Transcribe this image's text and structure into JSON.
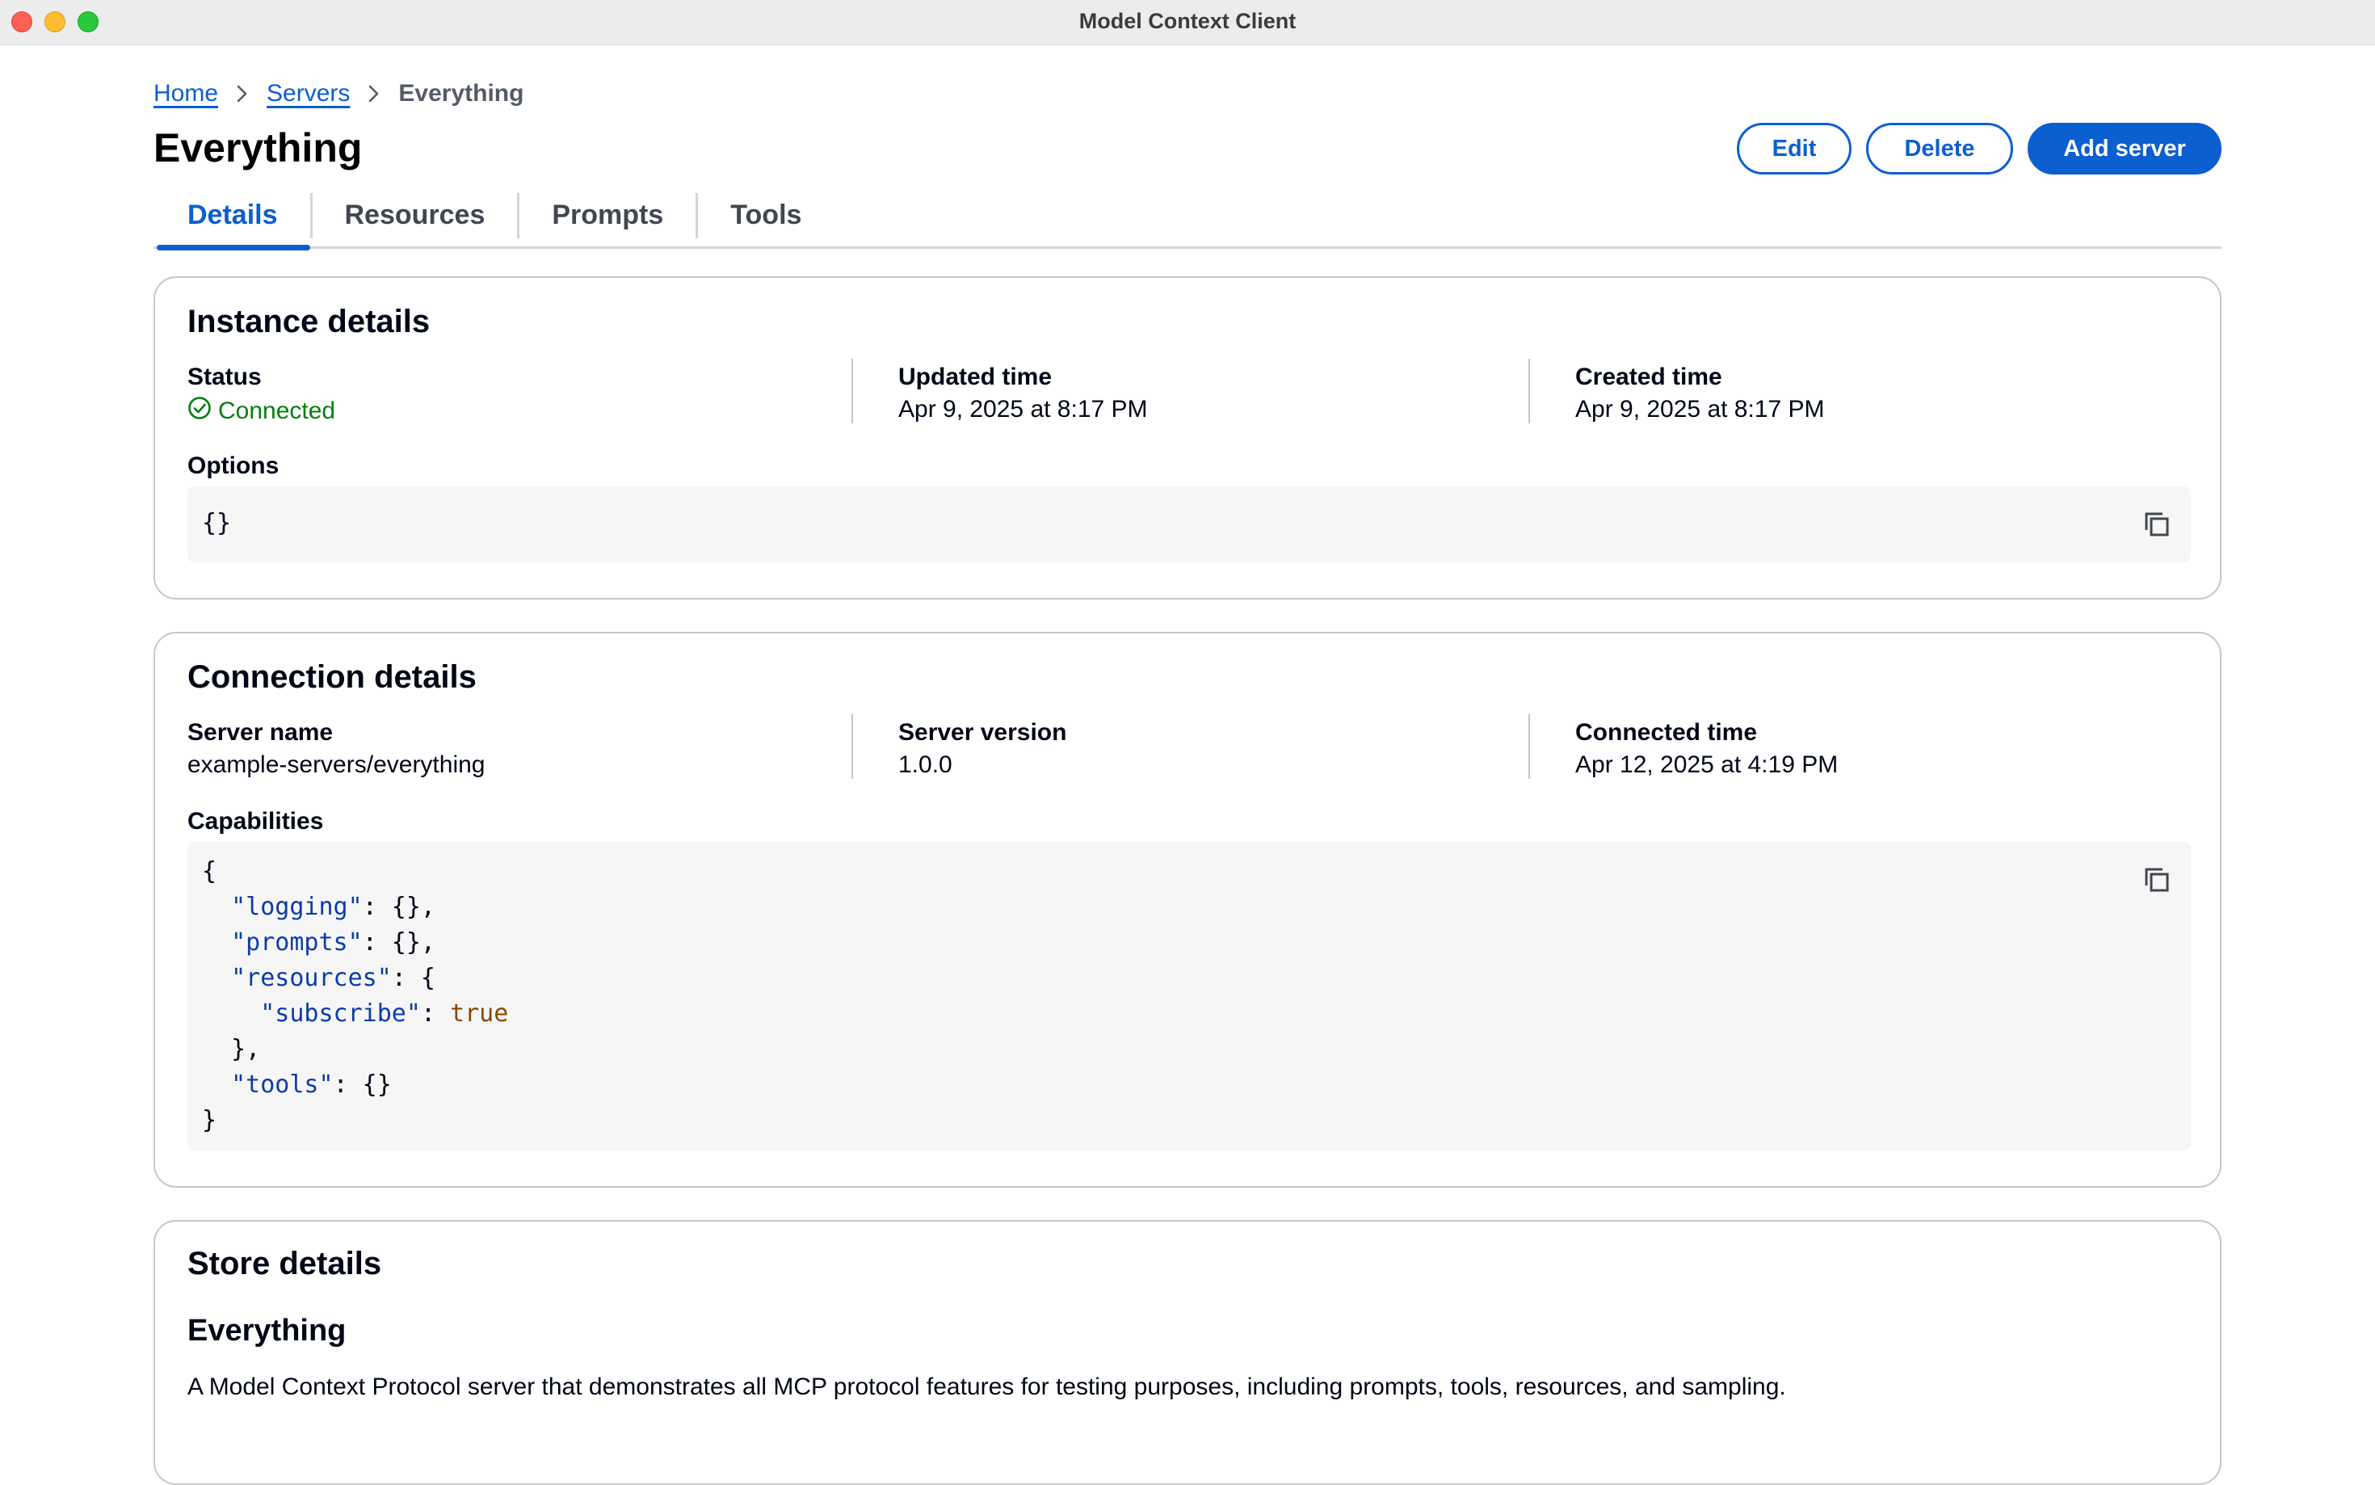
{
  "window": {
    "title": "Model Context Client"
  },
  "breadcrumb": {
    "items": [
      "Home",
      "Servers"
    ],
    "current": "Everything"
  },
  "page": {
    "title": "Everything"
  },
  "actions": {
    "edit_label": "Edit",
    "delete_label": "Delete",
    "add_label": "Add server"
  },
  "tabs": [
    {
      "label": "Details",
      "active": true
    },
    {
      "label": "Resources",
      "active": false
    },
    {
      "label": "Prompts",
      "active": false
    },
    {
      "label": "Tools",
      "active": false
    }
  ],
  "instance": {
    "title": "Instance details",
    "status_label": "Status",
    "status_value": "Connected",
    "updated_label": "Updated time",
    "updated_value": "Apr 9, 2025 at 8:17 PM",
    "created_label": "Created time",
    "created_value": "Apr 9, 2025 at 8:17 PM",
    "options_label": "Options",
    "options_code": "{}"
  },
  "connection": {
    "title": "Connection details",
    "server_name_label": "Server name",
    "server_name_value": "example-servers/everything",
    "server_version_label": "Server version",
    "server_version_value": "1.0.0",
    "connected_label": "Connected time",
    "connected_value": "Apr 12, 2025 at 4:19 PM",
    "capabilities_label": "Capabilities",
    "capabilities": {
      "open": "{",
      "logging_key": "\"logging\"",
      "logging_val": ": {},",
      "prompts_key": "\"prompts\"",
      "prompts_val": ": {},",
      "resources_key": "\"resources\"",
      "resources_val": ": {",
      "subscribe_key": "\"subscribe\"",
      "subscribe_sep": ": ",
      "subscribe_val": "true",
      "resources_close": "},",
      "tools_key": "\"tools\"",
      "tools_val": ": {}",
      "close": "}"
    }
  },
  "store": {
    "title": "Store details",
    "name": "Everything",
    "description": "A Model Context Protocol server that demonstrates all MCP protocol features for testing purposes, including prompts, tools, resources, and sampling."
  },
  "colors": {
    "accent": "#0b5fd1",
    "success": "#037f0c",
    "json_key": "#0c3ca8",
    "json_bool": "#8a4a00"
  },
  "icons": [
    "chevron-right-icon",
    "status-check-icon",
    "copy-icon"
  ]
}
